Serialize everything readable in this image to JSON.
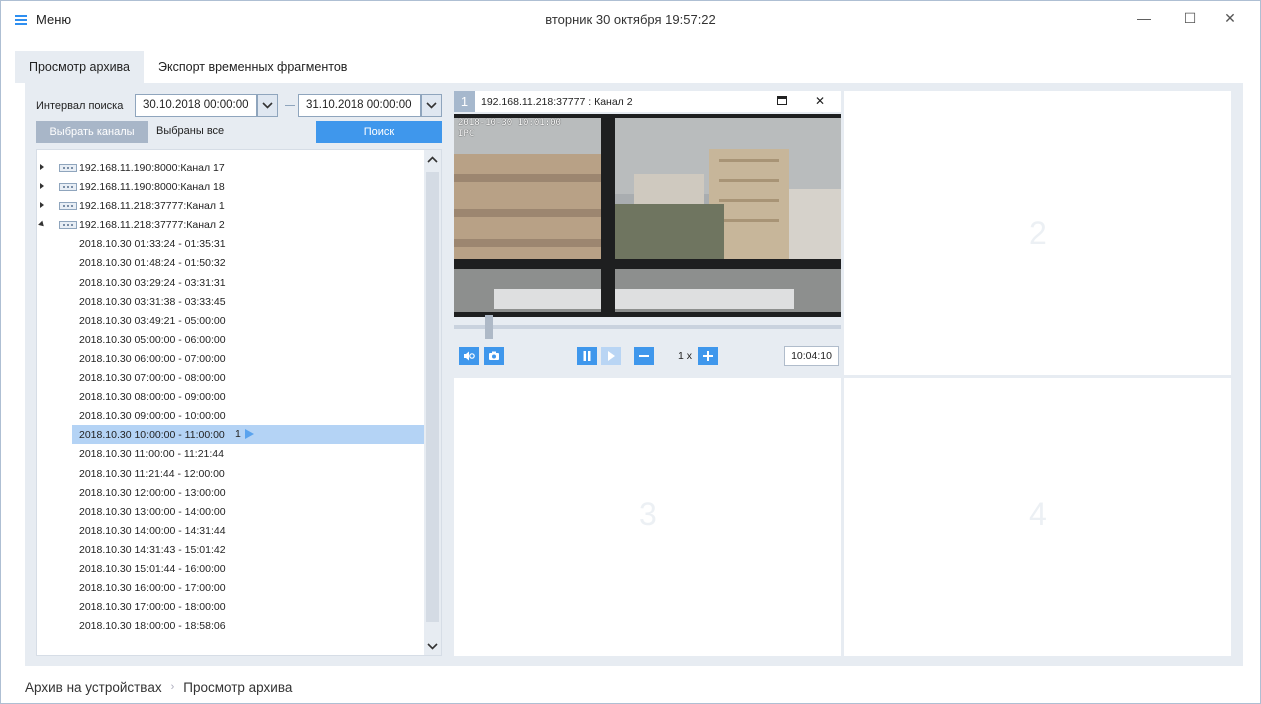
{
  "titlebar": {
    "menu_label": "Меню",
    "clock": "вторник 30 октября 19:57:22",
    "minimize": "—",
    "maximize": "☐",
    "close": "✕"
  },
  "tabs": [
    {
      "label": "Просмотр архива",
      "active": true
    },
    {
      "label": "Экспорт временных фрагментов",
      "active": false
    }
  ],
  "search": {
    "interval_label": "Интервал поиска",
    "from": "30.10.2018  00:00:00",
    "to": "31.10.2018  00:00:00",
    "select_channels_label": "Выбрать каналы",
    "selected_label": "Выбраны все",
    "search_button": "Поиск"
  },
  "tree": {
    "channels": [
      {
        "label": "192.168.11.190:8000:Канал 17",
        "expanded": false
      },
      {
        "label": "192.168.11.190:8000:Канал 18",
        "expanded": false
      },
      {
        "label": "192.168.11.218:37777:Канал 1",
        "expanded": false
      },
      {
        "label": "192.168.11.218:37777:Канал 2",
        "expanded": true
      }
    ],
    "records": [
      "2018.10.30 01:33:24 - 01:35:31",
      "2018.10.30 01:48:24 - 01:50:32",
      "2018.10.30 03:29:24 - 03:31:31",
      "2018.10.30 03:31:38 - 03:33:45",
      "2018.10.30 03:49:21 - 05:00:00",
      "2018.10.30 05:00:00 - 06:00:00",
      "2018.10.30 06:00:00 - 07:00:00",
      "2018.10.30 07:00:00 - 08:00:00",
      "2018.10.30 08:00:00 - 09:00:00",
      "2018.10.30 09:00:00 - 10:00:00",
      "2018.10.30 10:00:00 - 11:00:00",
      "2018.10.30 11:00:00 - 11:21:44",
      "2018.10.30 11:21:44 - 12:00:00",
      "2018.10.30 12:00:00 - 13:00:00",
      "2018.10.30 13:00:00 - 14:00:00",
      "2018.10.30 14:00:00 - 14:31:44",
      "2018.10.30 14:31:43 - 15:01:42",
      "2018.10.30 15:01:44 - 16:00:00",
      "2018.10.30 16:00:00 - 17:00:00",
      "2018.10.30 17:00:00 - 18:00:00",
      "2018.10.30 18:00:00 - 18:58:06"
    ],
    "selected_index": 10,
    "selected_marker": "1"
  },
  "player": {
    "cell1": {
      "badge": "1",
      "title": "192.168.11.218:37777 : Канал 2",
      "osd_line1": "2018-10-30 10:01:00",
      "osd_line2": "IPC",
      "speed": "1 x",
      "time": "10:04:10",
      "timeline_position": 0.08
    },
    "cell2_num": "2",
    "cell3_num": "3",
    "cell4_num": "4"
  },
  "statusbar": {
    "crumb1": "Архив на устройствах",
    "separator": "›",
    "crumb2": "Просмотр архива"
  },
  "colors": {
    "accent": "#3f97ec",
    "panel_bg": "#e7ecf2",
    "selected_row": "#b4d3f5"
  }
}
